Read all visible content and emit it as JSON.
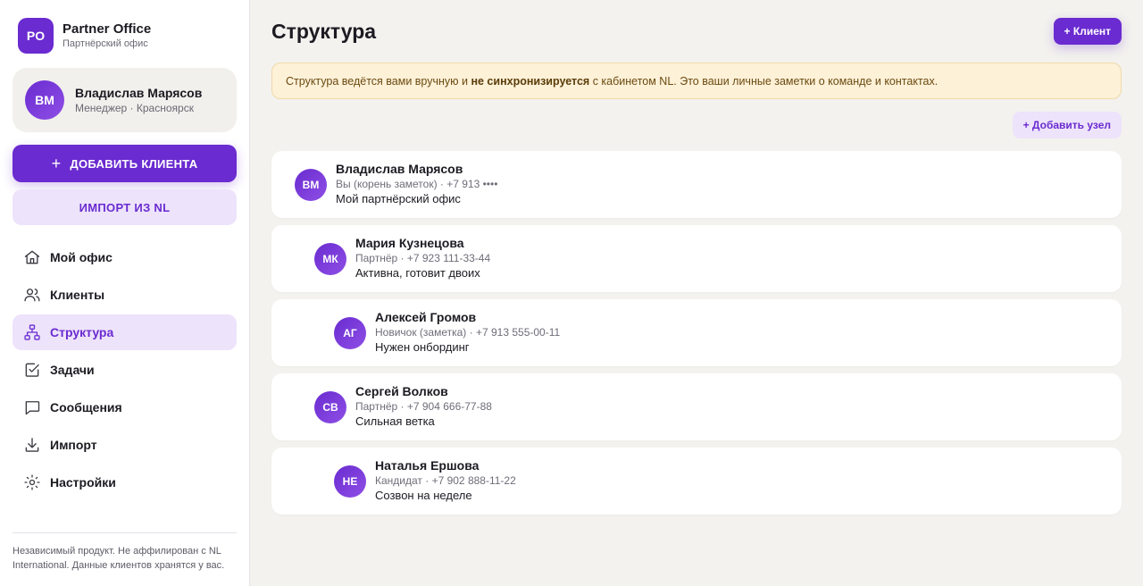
{
  "brand": {
    "logo": "PO",
    "title": "Partner Office",
    "subtitle": "Партнёрский офис"
  },
  "user": {
    "initials": "ВМ",
    "name": "Владислав Марясов",
    "role": "Менеджер · Красноярск"
  },
  "sidebar": {
    "add_client_label": "ДОБАВИТЬ КЛИЕНТА",
    "add_client_icon": "+",
    "import_label": "ИМПОРТ ИЗ NL",
    "nav": [
      {
        "label": "Мой офис",
        "icon": "home-icon",
        "active": false
      },
      {
        "label": "Клиенты",
        "icon": "users-icon",
        "active": false
      },
      {
        "label": "Структура",
        "icon": "hierarchy-icon",
        "active": true
      },
      {
        "label": "Задачи",
        "icon": "checkbox-icon",
        "active": false
      },
      {
        "label": "Сообщения",
        "icon": "message-icon",
        "active": false
      },
      {
        "label": "Импорт",
        "icon": "download-icon",
        "active": false
      },
      {
        "label": "Настройки",
        "icon": "gear-icon",
        "active": false
      }
    ],
    "footer": "Независимый продукт. Не аффилирован с NL International. Данные клиентов хранятся у вас."
  },
  "main": {
    "title": "Структура",
    "add_client_button": "+ Клиент",
    "notice": {
      "before": "Структура ведётся вами вручную и ",
      "bold": "не синхронизируется",
      "after": " с кабинетом NL. Это ваши личные заметки о команде и контактах."
    },
    "add_node_button": "+ Добавить узел",
    "nodes": [
      {
        "initials": "ВМ",
        "name": "Владислав Марясов",
        "meta": "Вы (корень заметок) · +7 913 ••••",
        "note": "Мой партнёрский офис",
        "level": 0
      },
      {
        "initials": "МК",
        "name": "Мария Кузнецова",
        "meta": "Партнёр · +7 923 111-33-44",
        "note": "Активна, готовит двоих",
        "level": 1
      },
      {
        "initials": "АГ",
        "name": "Алексей Громов",
        "meta": "Новичок (заметка) · +7 913 555-00-11",
        "note": "Нужен онбординг",
        "level": 2
      },
      {
        "initials": "СВ",
        "name": "Сергей Волков",
        "meta": "Партнёр · +7 904 666-77-88",
        "note": "Сильная ветка",
        "level": 1
      },
      {
        "initials": "НЕ",
        "name": "Наталья Ершова",
        "meta": "Кандидат · +7 902 888-11-22",
        "note": "Созвон на неделе",
        "level": 2
      }
    ]
  },
  "colors": {
    "accent": "#6a2bd0",
    "accent_soft": "#ede3fb",
    "notice_bg": "#fdf1d8",
    "page_bg": "#f3f2ee"
  }
}
